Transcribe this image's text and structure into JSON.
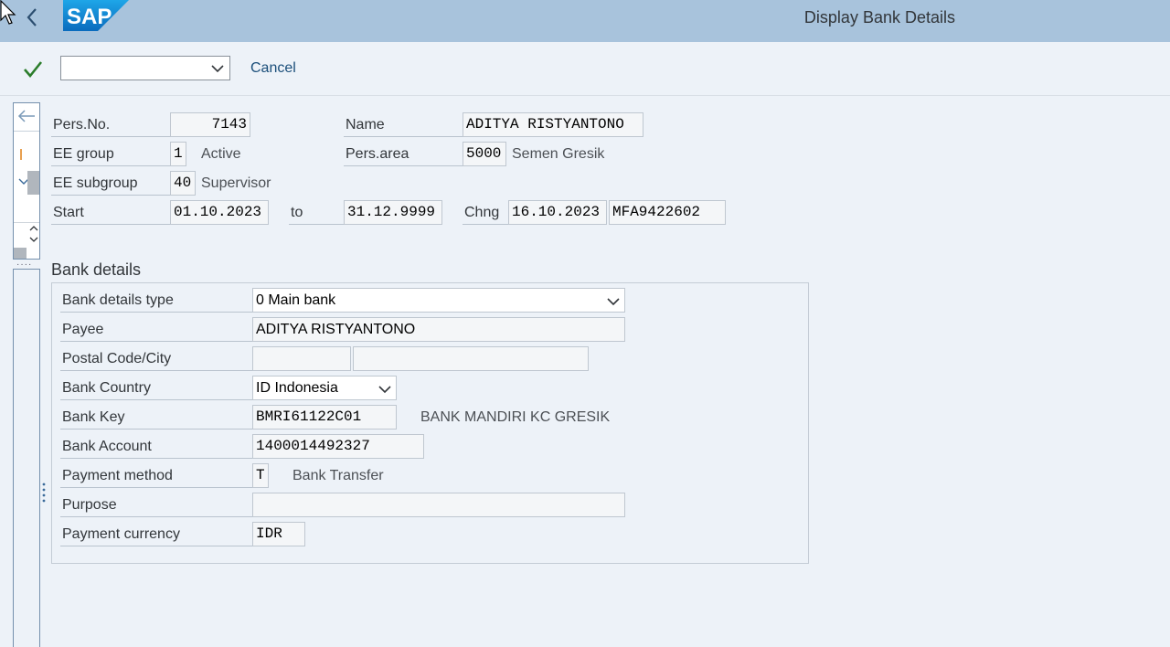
{
  "header": {
    "title": "Display Bank Details",
    "logo_text": "SAP",
    "color": "#a8c3dc"
  },
  "toolbar": {
    "command_field_value": "",
    "cancel_label": "Cancel"
  },
  "personnel": {
    "pers_no_label": "Pers.No.",
    "pers_no_value": "7143",
    "name_label": "Name",
    "name_value": "ADITYA RISTYANTONO",
    "ee_group_label": "EE group",
    "ee_group_value": "1",
    "ee_group_text": "Active",
    "pers_area_label": "Pers.area",
    "pers_area_value": "5000",
    "pers_area_text": "Semen Gresik",
    "ee_subgroup_label": "EE subgroup",
    "ee_subgroup_value": "40",
    "ee_subgroup_text": "Supervisor",
    "start_label": "Start",
    "start_value": "01.10.2023",
    "to_label": "to",
    "to_value": "31.12.9999",
    "chng_label": "Chng",
    "chng_date": "16.10.2023",
    "chng_user": "MFA9422602"
  },
  "bank": {
    "section_title": "Bank details",
    "type_label": "Bank details type",
    "type_value": "0 Main bank",
    "payee_label": "Payee",
    "payee_value": "ADITYA RISTYANTONO",
    "postal_label": "Postal Code/City",
    "postal_code": "",
    "city": "",
    "country_label": "Bank Country",
    "country_value": "ID Indonesia",
    "key_label": "Bank Key",
    "key_value": "BMRI61122C01",
    "key_text": "BANK MANDIRI KC GRESIK",
    "account_label": "Bank Account",
    "account_value": "1400014492327",
    "method_label": "Payment method",
    "method_value": "T",
    "method_text": "Bank Transfer",
    "purpose_label": "Purpose",
    "purpose_value": "",
    "currency_label": "Payment currency",
    "currency_value": "IDR"
  },
  "icons": {
    "back": "chevron-left-icon",
    "check": "check-icon",
    "dropdown": "chevron-down-icon",
    "nav_back": "arrow-left-icon"
  },
  "colors": {
    "accent_check": "#2b7d2b",
    "link": "#1a4e7a",
    "background": "#edf2f8"
  }
}
